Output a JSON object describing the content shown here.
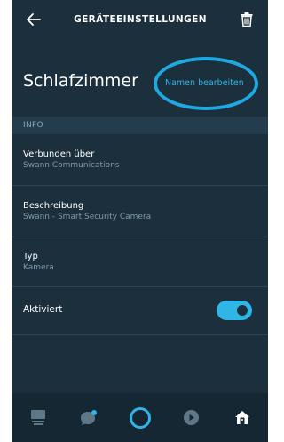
{
  "header": {
    "title": "GERÄTEEINSTELLUNGEN",
    "back_icon": "arrow-left-icon",
    "delete_icon": "trash-icon"
  },
  "device": {
    "name": "Schlafzimmer",
    "rename_label": "Namen bearbeiten"
  },
  "info_section": {
    "heading": "INFO",
    "fields": [
      {
        "label": "Verbunden über",
        "value": "Swann Communications"
      },
      {
        "label": "Beschreibung",
        "value": "Swann - Smart Security Camera"
      },
      {
        "label": "Typ",
        "value": "Kamera"
      }
    ]
  },
  "enabled": {
    "label": "Aktiviert",
    "state": true
  },
  "bottom_nav": {
    "items": [
      {
        "icon": "home-feed-icon"
      },
      {
        "icon": "communicate-icon"
      },
      {
        "icon": "alexa-ring-icon"
      },
      {
        "icon": "play-icon"
      },
      {
        "icon": "devices-icon",
        "active": true
      }
    ]
  },
  "colors": {
    "background": "#1b2f3d",
    "accent": "#2fb5e6",
    "section_bar": "#243d4e",
    "secondary_text": "#7f9bad"
  }
}
